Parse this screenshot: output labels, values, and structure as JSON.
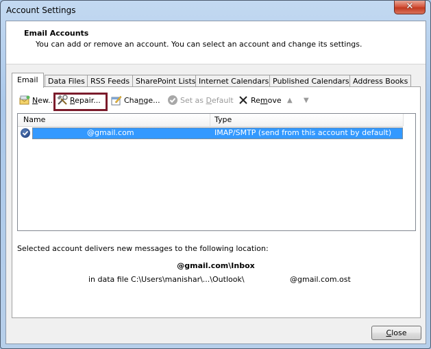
{
  "window": {
    "title": "Account Settings",
    "close_glyph": "✕"
  },
  "header": {
    "title": "Email Accounts",
    "subtitle": "You can add or remove an account. You can select an account and change its settings."
  },
  "tabs": [
    {
      "label": "Email",
      "active": true
    },
    {
      "label": "Data Files"
    },
    {
      "label": "RSS Feeds"
    },
    {
      "label": "SharePoint Lists"
    },
    {
      "label": "Internet Calendars"
    },
    {
      "label": "Published Calendars"
    },
    {
      "label": "Address Books"
    }
  ],
  "toolbar": {
    "new_pre": "",
    "new_key": "N",
    "new_post": "ew...",
    "repair_pre": "",
    "repair_key": "R",
    "repair_post": "epair...",
    "change_pre": "Cha",
    "change_key": "n",
    "change_post": "ge...",
    "default_pre": "Set as ",
    "default_key": "D",
    "default_post": "efault",
    "remove_pre": "Re",
    "remove_key": "m",
    "remove_post": "ove",
    "move_up": "▲",
    "move_down": "▼"
  },
  "list": {
    "columns": {
      "name": "Name",
      "type": "Type"
    },
    "rows": [
      {
        "name": "@gmail.com",
        "type": "IMAP/SMTP (send from this account by default)",
        "selected": true,
        "default": true
      }
    ]
  },
  "delivery": {
    "label": "Selected account delivers new messages to the following location:",
    "folder": "@gmail.com\\Inbox",
    "file_prefix": "in data file C:\\Users\\manishar\\...\\Outlook\\",
    "file_suffix": "@gmail.com.ost"
  },
  "footer": {
    "close_key": "C",
    "close_rest": "lose"
  }
}
